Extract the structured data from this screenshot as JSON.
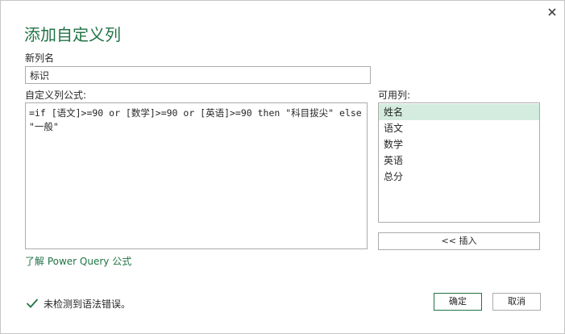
{
  "dialog": {
    "title": "添加自定义列",
    "close_glyph": "✕"
  },
  "name_field": {
    "label": "新列名",
    "value": "标识"
  },
  "formula_field": {
    "label": "自定义列公式:",
    "value": "=if [语文]>=90 or [数学]>=90 or [英语]>=90 then \"科目拔尖\" else\n\"一般\""
  },
  "columns": {
    "label": "可用列:",
    "items": [
      {
        "label": "姓名",
        "selected": true
      },
      {
        "label": "语文",
        "selected": false
      },
      {
        "label": "数学",
        "selected": false
      },
      {
        "label": "英语",
        "selected": false
      },
      {
        "label": "总分",
        "selected": false
      }
    ],
    "insert_label": "<< 插入"
  },
  "help_link": "了解 Power Query 公式",
  "status": {
    "message": "未检测到语法错误。",
    "icon": "check-icon",
    "color": "#217346"
  },
  "buttons": {
    "ok": "确定",
    "cancel": "取消"
  },
  "colors": {
    "accent": "#217346",
    "selection": "#d3ecdf",
    "border": "#ababab"
  }
}
